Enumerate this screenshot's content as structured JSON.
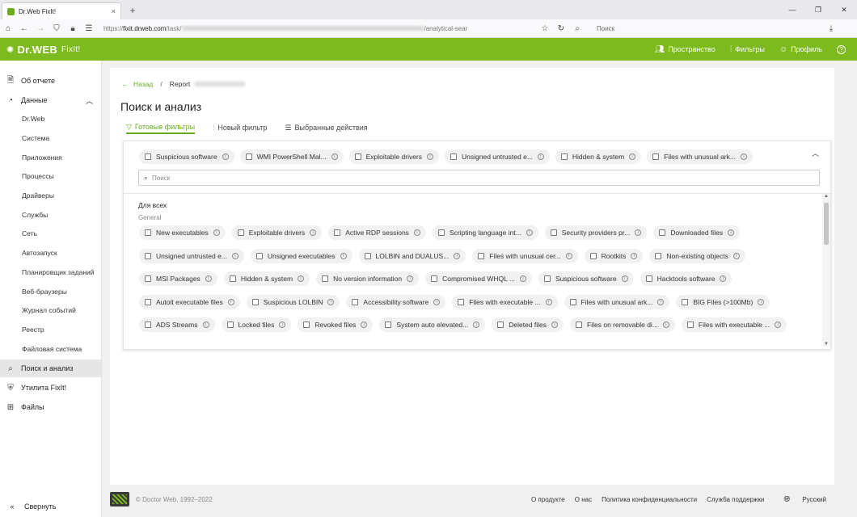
{
  "browser": {
    "tab_title": "Dr.Web FixIt!",
    "close_glyph": "×",
    "new_tab_glyph": "+",
    "url_prefix": "https://",
    "url_host": "fixit.drweb.com",
    "url_path_start": "/task/",
    "url_path_end": "/analytical-search",
    "search_placeholder": "Поиск",
    "minimize_glyph": "—",
    "maximize_glyph": "❐",
    "close_window_glyph": "✕"
  },
  "app": {
    "brand": "Dr.WEB",
    "product": "FixIt!",
    "actions": [
      {
        "label": "Пространство",
        "icon": "people-icon"
      },
      {
        "label": "Фильтры",
        "icon": "filters-icon"
      },
      {
        "label": "Профиль",
        "icon": "user-icon"
      }
    ],
    "help_glyph": "?"
  },
  "sidebar": {
    "items": [
      {
        "label": "Об отчете",
        "icon": "document-icon",
        "level": "top"
      },
      {
        "label": "Данные",
        "icon": "data-icon",
        "level": "top",
        "expanded": true
      },
      {
        "label": "Dr.Web",
        "level": "sub"
      },
      {
        "label": "Система",
        "level": "sub"
      },
      {
        "label": "Приложения",
        "level": "sub"
      },
      {
        "label": "Процессы",
        "level": "sub"
      },
      {
        "label": "Драйверы",
        "level": "sub"
      },
      {
        "label": "Службы",
        "level": "sub"
      },
      {
        "label": "Сеть",
        "level": "sub"
      },
      {
        "label": "Автозапуск",
        "level": "sub"
      },
      {
        "label": "Планировщик заданий",
        "level": "sub"
      },
      {
        "label": "Веб-браузеры",
        "level": "sub"
      },
      {
        "label": "Журнал событий",
        "level": "sub"
      },
      {
        "label": "Реестр",
        "level": "sub"
      },
      {
        "label": "Файловая система",
        "level": "sub"
      },
      {
        "label": "Поиск и анализ",
        "icon": "search-icon",
        "level": "top",
        "active": true
      },
      {
        "label": "Утилита FixIt!",
        "icon": "shield-icon",
        "level": "top"
      },
      {
        "label": "Файлы",
        "icon": "file-add-icon",
        "level": "top"
      }
    ],
    "collapse_label": "Свернуть"
  },
  "main": {
    "breadcrumb_back": "Назад",
    "breadcrumb_sep": "/",
    "breadcrumb_report": "Report",
    "title": "Поиск и анализ",
    "tabs": [
      {
        "label": "Готовые фильтры",
        "active": true
      },
      {
        "label": "Новый фильтр"
      },
      {
        "label": "Выбранные действия"
      }
    ],
    "selected_filters": [
      "Suspicious software",
      "WMI PowerShell Mal...",
      "Exploitable drivers",
      "Unsigned untrusted e...",
      "Hidden & system",
      "Files with unusual ark..."
    ],
    "search_placeholder": "Поиск",
    "group_title": "Для всех",
    "group_subtitle": "General",
    "filter_rows": [
      [
        "New executables",
        "Exploitable drivers",
        "Active RDP sessions",
        "Scripting language int...",
        "Security providers pr...",
        "Downloaded files"
      ],
      [
        "Unsigned untrusted e...",
        "Unsigned executables",
        "LOLBIN and DUALUS...",
        "Files with unusual cer...",
        "Rootkits",
        "Non-existing objects"
      ],
      [
        "MSI Packages",
        "Hidden & system",
        "No version information",
        "Compromised WHQL ...",
        "Suspicious software",
        "Hacktools software"
      ],
      [
        "Autoit executable files",
        "Suspicious LOLBIN",
        "Accessibility software",
        "Files with executable ...",
        "Files with unusual ark...",
        "BIG Files (>100Mb)"
      ],
      [
        "ADS Streams",
        "Locked files",
        "Revoked files",
        "System auto elevated...",
        "Deleted files",
        "Files on removable di...",
        "Files with executable ..."
      ]
    ]
  },
  "footer": {
    "copyright": "© Doctor Web, 1992–2022",
    "links": [
      "О продукте",
      "О нас",
      "Политика конфиденциальности",
      "Служба поддержки"
    ],
    "language": "Русский"
  }
}
